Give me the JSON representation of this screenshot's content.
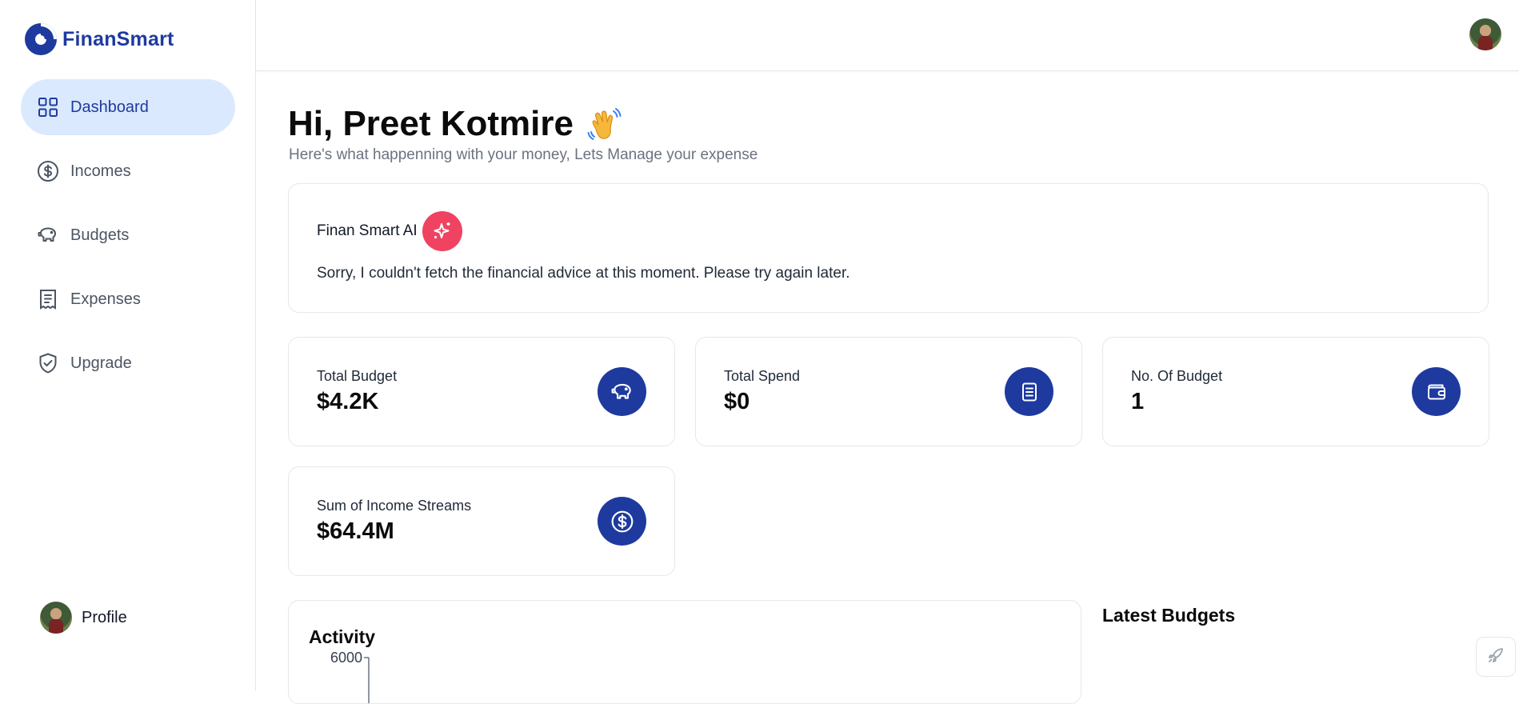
{
  "app": {
    "name": "FinanSmart",
    "brand_color": "#1e3a9f"
  },
  "sidebar": {
    "items": [
      {
        "label": "Dashboard",
        "icon": "grid-icon",
        "active": true
      },
      {
        "label": "Incomes",
        "icon": "dollar-circle-icon",
        "active": false
      },
      {
        "label": "Budgets",
        "icon": "piggy-bank-icon",
        "active": false
      },
      {
        "label": "Expenses",
        "icon": "receipt-icon",
        "active": false
      },
      {
        "label": "Upgrade",
        "icon": "shield-check-icon",
        "active": false
      }
    ],
    "profile_label": "Profile"
  },
  "header": {
    "greeting": "Hi, Preet Kotmire",
    "wave_icon": "waving-hand-icon",
    "subtitle": "Here's what happenning with your money, Lets Manage your expense"
  },
  "ai_card": {
    "title": "Finan Smart AI",
    "icon": "sparkles-icon",
    "icon_color": "#ef4361",
    "message": "Sorry, I couldn't fetch the financial advice at this moment. Please try again later."
  },
  "stats": [
    {
      "label": "Total Budget",
      "value": "$4.2K",
      "icon": "piggy-bank-icon"
    },
    {
      "label": "Total Spend",
      "value": "$0",
      "icon": "receipt-icon"
    },
    {
      "label": "No. Of Budget",
      "value": "1",
      "icon": "wallet-icon"
    },
    {
      "label": "Sum of Income Streams",
      "value": "$64.4M",
      "icon": "dollar-circle-icon"
    }
  ],
  "activity": {
    "title": "Activity",
    "y_tick_top": "6000"
  },
  "latest_budgets": {
    "title": "Latest Budgets"
  },
  "floating_button": {
    "icon": "rocket-icon"
  }
}
